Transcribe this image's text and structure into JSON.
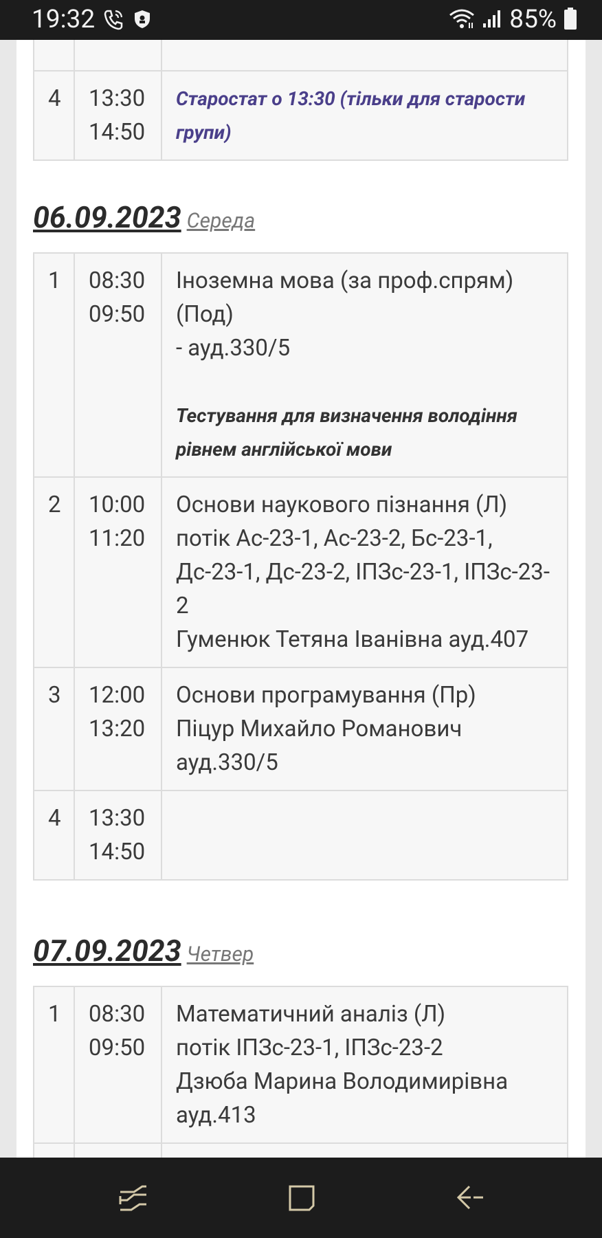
{
  "status_bar": {
    "time": "19:32",
    "battery": "85%",
    "icons": [
      "call-icon",
      "shield-icon",
      "wifi-icon",
      "signal-icon",
      "battery-icon"
    ]
  },
  "top_partial_table": {
    "rows": [
      {
        "num": "4",
        "start": "13:30",
        "end": "14:50",
        "note": "Старостат о 13:30 (тільки для старости групи)"
      }
    ]
  },
  "days": [
    {
      "date": "06.09.2023",
      "weekday": "Середа",
      "rows": [
        {
          "num": "1",
          "start": "08:30",
          "end": "09:50",
          "lines": [
            "Іноземна мова (за проф.спрям) (Под)",
            "- ауд.330/5"
          ],
          "note": "Тестування для визначення володіння рівнем англійської мови"
        },
        {
          "num": "2",
          "start": "10:00",
          "end": "11:20",
          "lines": [
            "Основи наукового пізнання (Л)",
            "потік Ас-23-1, Ас-23-2, Бс-23-1, Дс-23-1, Дс-23-2, ІПЗс-23-1, ІПЗс-23-2",
            "Гуменюк Тетяна Іванівна ауд.407"
          ]
        },
        {
          "num": "3",
          "start": "12:00",
          "end": "13:20",
          "lines": [
            "Основи програмування (Пр)",
            "Піцур Михайло Романович ауд.330/5"
          ]
        },
        {
          "num": "4",
          "start": "13:30",
          "end": "14:50",
          "lines": []
        }
      ]
    },
    {
      "date": "07.09.2023",
      "weekday": "Четвер",
      "rows": [
        {
          "num": "1",
          "start": "08:30",
          "end": "09:50",
          "lines": [
            "Математичний аналіз (Л)",
            "потік ІПЗс-23-1, ІПЗс-23-2",
            "Дзюба Марина Володимирівна ауд.413"
          ]
        }
      ]
    }
  ],
  "nav_bar": {
    "buttons": [
      "recents-icon",
      "home-icon",
      "back-icon"
    ]
  }
}
